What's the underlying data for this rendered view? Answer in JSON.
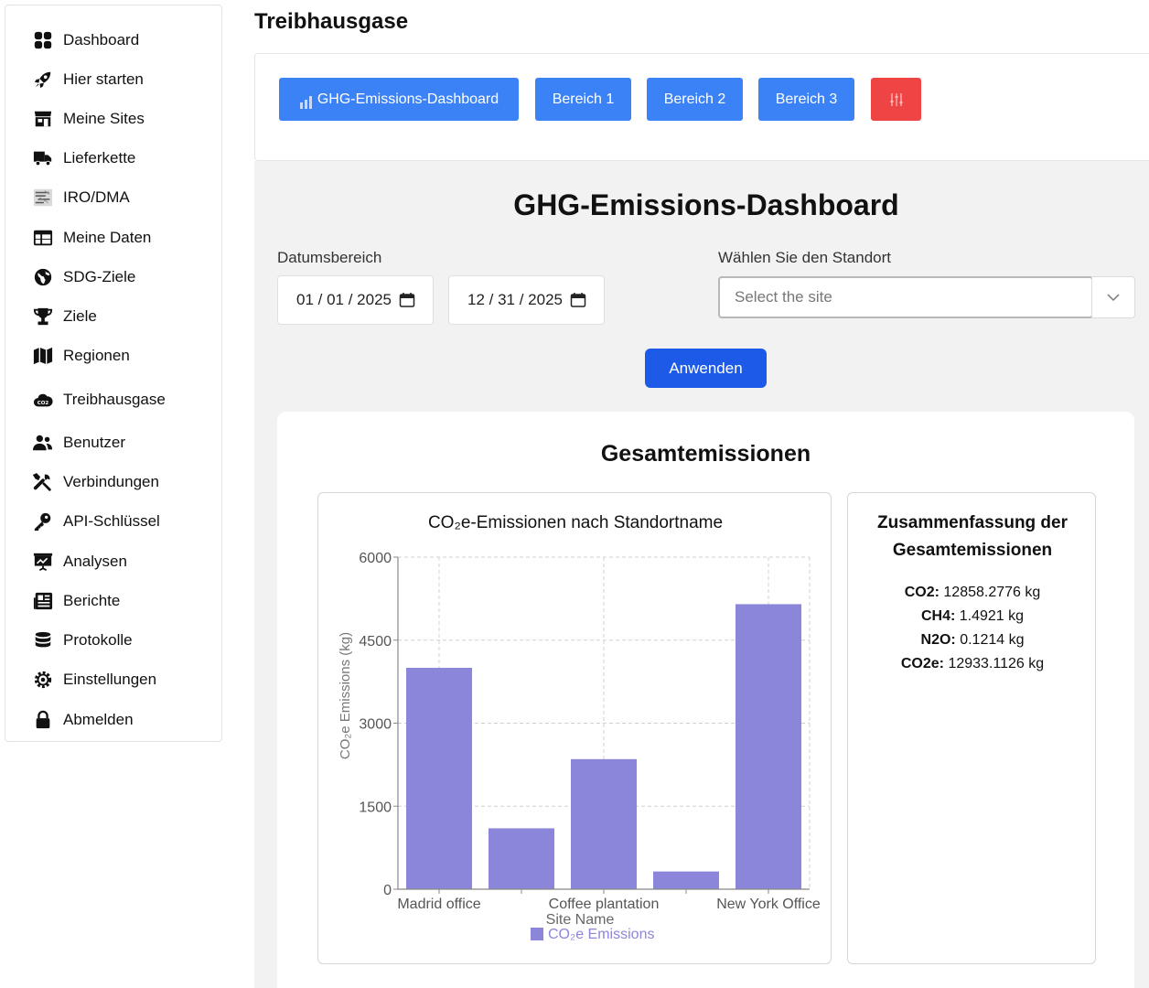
{
  "sidebar": {
    "items": [
      {
        "label": "Dashboard",
        "icon": "dashboard-icon"
      },
      {
        "label": "Hier starten",
        "icon": "rocket-icon"
      },
      {
        "label": "Meine Sites",
        "icon": "store-icon"
      },
      {
        "label": "Lieferkette",
        "icon": "truck-icon"
      },
      {
        "label": "IRO/DMA",
        "icon": "iro-image-icon"
      },
      {
        "label": "Meine Daten",
        "icon": "table-icon"
      },
      {
        "label": "SDG-Ziele",
        "icon": "globe-icon"
      },
      {
        "label": "Ziele",
        "icon": "trophy-icon"
      },
      {
        "label": "Regionen",
        "icon": "map-icon"
      },
      {
        "label": "Treibhausgase",
        "icon": "co2-cloud-icon"
      },
      {
        "label": "Benutzer",
        "icon": "users-icon"
      },
      {
        "label": "Verbindungen",
        "icon": "tools-icon"
      },
      {
        "label": "API-Schlüssel",
        "icon": "key-icon"
      },
      {
        "label": "Analysen",
        "icon": "presentation-icon"
      },
      {
        "label": "Berichte",
        "icon": "newspaper-icon"
      },
      {
        "label": "Protokolle",
        "icon": "database-icon"
      },
      {
        "label": "Einstellungen",
        "icon": "gear-icon"
      },
      {
        "label": "Abmelden",
        "icon": "lock-icon"
      }
    ]
  },
  "header": {
    "title": "Treibhausgase"
  },
  "tabs": [
    {
      "label": "GHG-Emissions-Dashboard",
      "icon": "bar-chart-icon"
    },
    {
      "label": "Bereich 1"
    },
    {
      "label": "Bereich 2"
    },
    {
      "label": "Bereich 3"
    },
    {
      "label": "",
      "icon": "sliders-icon"
    }
  ],
  "dashboard": {
    "title": "GHG-Emissions-Dashboard",
    "date_range_label": "Datumsbereich",
    "date_from": "01 / 01 / 2025",
    "date_to": "12 / 31 / 2025",
    "site_label": "Wählen Sie den Standort",
    "site_placeholder": "Select the site",
    "apply_label": "Anwenden",
    "total_title": "Gesamtemissionen"
  },
  "summary": {
    "title": "Zusammenfassung der Gesamtemissionen",
    "rows": [
      {
        "key": "CO2:",
        "value": "12858.2776 kg"
      },
      {
        "key": "CH4:",
        "value": "1.4921 kg"
      },
      {
        "key": "N2O:",
        "value": "0.1214 kg"
      },
      {
        "key": "CO2e:",
        "value": "12933.1126 kg"
      }
    ]
  },
  "colors": {
    "primary": "#3b82f6",
    "danger": "#ef4444",
    "apply": "#1d5ae8",
    "bar": "#8b86d9"
  },
  "chart_data": {
    "type": "bar",
    "title": "CO₂e-Emissionen nach Standortname",
    "categories": [
      "Madrid office",
      "",
      "Coffee plantation",
      "",
      "New York Office"
    ],
    "values": [
      4000,
      1100,
      2350,
      320,
      5150
    ],
    "xlabel": "Site Name",
    "ylabel": "CO₂e Emissions (kg)",
    "ylim": [
      0,
      6000
    ],
    "yticks": [
      0,
      1500,
      3000,
      4500,
      6000
    ],
    "grid": true,
    "legend": "bottom",
    "series": [
      {
        "name": "CO₂e Emissions",
        "values": [
          4000,
          1100,
          2350,
          320,
          5150
        ]
      }
    ]
  }
}
